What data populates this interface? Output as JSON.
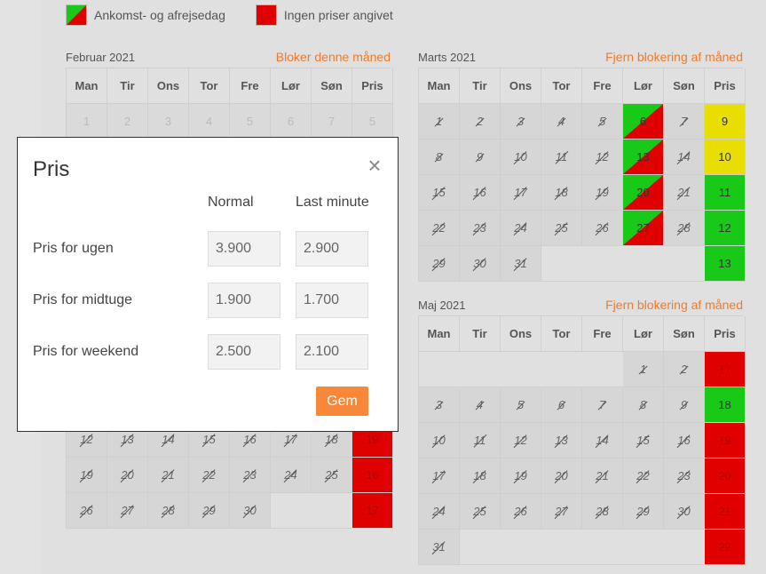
{
  "legend": {
    "item1": "Ankomst- og afrejsedag",
    "item2": "Ingen priser angivet"
  },
  "weekdays": [
    "Man",
    "Tir",
    "Ons",
    "Tor",
    "Fre",
    "Lør",
    "Søn",
    "Pris"
  ],
  "calendars": {
    "feb": {
      "title": "Februar 2021",
      "action": "Bloker denne måned",
      "first_row": [
        "1",
        "2",
        "3",
        "4",
        "5",
        "6",
        "7",
        "5"
      ],
      "visible_rows": [
        [
          "12",
          "13",
          "14",
          "15",
          "16",
          "17",
          "18",
          "19"
        ],
        [
          "19",
          "20",
          "21",
          "22",
          "23",
          "24",
          "25",
          "16"
        ],
        [
          "26",
          "27",
          "28",
          "29",
          "30",
          "",
          "",
          "17"
        ]
      ]
    },
    "mar": {
      "title": "Marts 2021",
      "action": "Fjern blokering af måned",
      "rows": [
        [
          "1",
          "2",
          "3",
          "4",
          "5",
          "6",
          "7",
          "9"
        ],
        [
          "8",
          "9",
          "10",
          "11",
          "12",
          "13",
          "14",
          "10"
        ],
        [
          "15",
          "16",
          "17",
          "18",
          "19",
          "20",
          "21",
          "11"
        ],
        [
          "22",
          "23",
          "24",
          "25",
          "26",
          "27",
          "28",
          "12"
        ],
        [
          "29",
          "30",
          "31",
          "",
          "",
          "",
          "",
          "13"
        ]
      ]
    },
    "may": {
      "title": "Maj 2021",
      "action": "Fjern blokering af måned",
      "rows": [
        [
          "",
          "",
          "",
          "",
          "",
          "1",
          "2",
          "17"
        ],
        [
          "3",
          "4",
          "5",
          "6",
          "7",
          "8",
          "9",
          "18"
        ],
        [
          "10",
          "11",
          "12",
          "13",
          "14",
          "15",
          "16",
          "19"
        ],
        [
          "17",
          "18",
          "19",
          "20",
          "21",
          "22",
          "23",
          "20"
        ],
        [
          "24",
          "25",
          "26",
          "27",
          "28",
          "29",
          "30",
          "21"
        ],
        [
          "31",
          "",
          "",
          "",
          "",
          "",
          "",
          "22"
        ]
      ]
    }
  },
  "modal": {
    "title": "Pris",
    "close_icon": "×",
    "col_normal": "Normal",
    "col_lastminute": "Last minute",
    "rows": [
      {
        "label": "Pris for ugen",
        "normal": "3.900",
        "lastminute": "2.900"
      },
      {
        "label": "Pris for midtuge",
        "normal": "1.900",
        "lastminute": "1.700"
      },
      {
        "label": "Pris for weekend",
        "normal": "2.500",
        "lastminute": "2.100"
      }
    ],
    "save_label": "Gem"
  },
  "colors": {
    "accent": "#f07a2a",
    "red": "#e00000",
    "green": "#18c918",
    "yellow": "#e8df00"
  }
}
